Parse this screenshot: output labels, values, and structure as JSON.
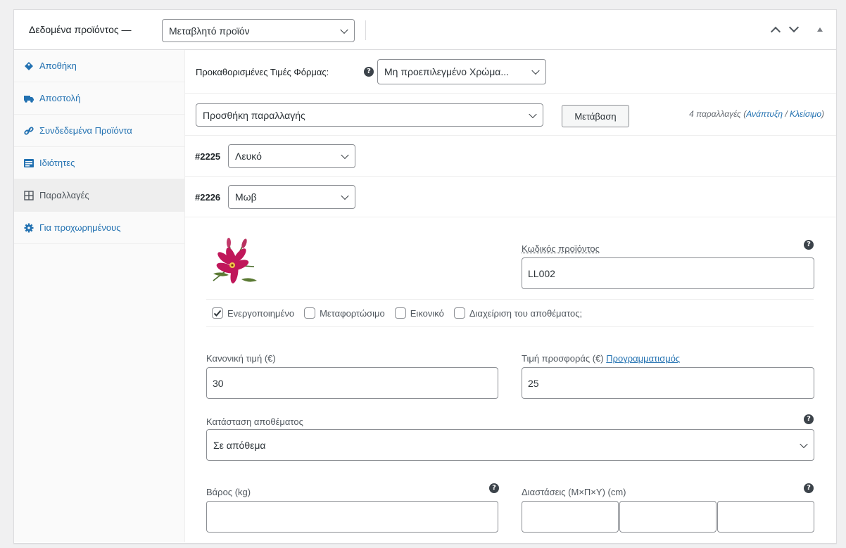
{
  "header": {
    "title": "Δεδομένα προϊόντος —",
    "product_type": "Μεταβλητό προϊόν"
  },
  "sidebar": {
    "items": [
      {
        "label": "Αποθήκη",
        "icon": "tag-icon"
      },
      {
        "label": "Αποστολή",
        "icon": "truck-icon"
      },
      {
        "label": "Συνδεδεμένα Προϊόντα",
        "icon": "link-icon"
      },
      {
        "label": "Ιδιότητες",
        "icon": "list-icon"
      },
      {
        "label": "Παραλλαγές",
        "icon": "grid-icon",
        "active": true
      },
      {
        "label": "Για προχωρημένους",
        "icon": "gear-icon"
      }
    ]
  },
  "defaults": {
    "label": "Προκαθορισμένες Τιμές Φόρμας:",
    "value": "Μη προεπιλεγμένο Χρώμα..."
  },
  "variations_bar": {
    "action": "Προσθήκη παραλλαγής",
    "go_button": "Μετάβαση",
    "count_text": "4 παραλλαγές (",
    "expand": "Ανάπτυξη",
    "slash": " / ",
    "close": "Κλείσιμο",
    "end": ")"
  },
  "variations": [
    {
      "id": "#2225",
      "value": "Λευκό"
    },
    {
      "id": "#2226",
      "value": "Μωβ"
    }
  ],
  "variation_detail": {
    "sku_label": "Κωδικός προϊόντος",
    "sku_value": "LL002",
    "checkboxes": [
      {
        "label": "Ενεργοποιημένο",
        "checked": true
      },
      {
        "label": "Μεταφορτώσιμο",
        "checked": false
      },
      {
        "label": "Εικονικό",
        "checked": false
      },
      {
        "label": "Διαχείριση του αποθέματος;",
        "checked": false
      }
    ],
    "regular_price_label": "Κανονική τιμή (€)",
    "regular_price": "30",
    "sale_price_label": "Τιμή προσφοράς (€) ",
    "schedule_link": "Προγραμματισμός",
    "sale_price": "25",
    "stock_status_label": "Κατάσταση αποθέματος",
    "stock_status": "Σε απόθεμα",
    "weight_label": "Βάρος (kg)",
    "dimensions_label": "Διαστάσεις (Μ×Π×Υ) (cm)"
  },
  "colors": {
    "link": "#2271b1",
    "border": "#8c8f94",
    "sidebar_bg": "#fafafa",
    "active_tab_bg": "#eeeeee"
  }
}
